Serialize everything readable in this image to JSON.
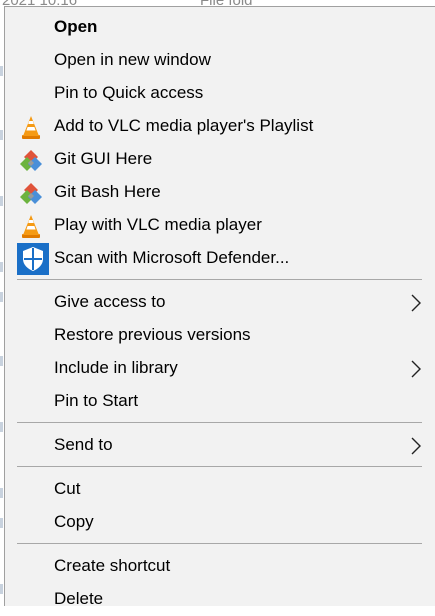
{
  "background": {
    "date_fragment": "2021 10:16",
    "type_fragment": "File fold"
  },
  "menu": {
    "items": {
      "open": {
        "label": "Open",
        "icon": ""
      },
      "open_new_window": {
        "label": "Open in new window",
        "icon": ""
      },
      "pin_quick_access": {
        "label": "Pin to Quick access",
        "icon": ""
      },
      "vlc_playlist": {
        "label": "Add to VLC media player's Playlist",
        "icon": "vlc-cone-icon"
      },
      "git_gui": {
        "label": "Git GUI Here",
        "icon": "git-gui-icon"
      },
      "git_bash": {
        "label": "Git Bash Here",
        "icon": "git-bash-icon"
      },
      "vlc_play": {
        "label": "Play with VLC media player",
        "icon": "vlc-cone-icon"
      },
      "defender": {
        "label": "Scan with Microsoft Defender...",
        "icon": "defender-shield-icon"
      },
      "give_access": {
        "label": "Give access to",
        "icon": "",
        "submenu": true
      },
      "restore_versions": {
        "label": "Restore previous versions",
        "icon": ""
      },
      "include_library": {
        "label": "Include in library",
        "icon": "",
        "submenu": true
      },
      "pin_start": {
        "label": "Pin to Start",
        "icon": ""
      },
      "send_to": {
        "label": "Send to",
        "icon": "",
        "submenu": true
      },
      "cut": {
        "label": "Cut",
        "icon": ""
      },
      "copy": {
        "label": "Copy",
        "icon": ""
      },
      "create_shortcut": {
        "label": "Create shortcut",
        "icon": ""
      },
      "delete": {
        "label": "Delete",
        "icon": ""
      }
    }
  },
  "colors": {
    "menu_background": "#f2f2f2",
    "separator": "#a8a8a8",
    "vlc_orange": "#f08a00",
    "defender_blue": "#1a6fc7",
    "git_red": "#e0533a",
    "git_green": "#6cb33e",
    "git_blue": "#4a8fd8"
  }
}
